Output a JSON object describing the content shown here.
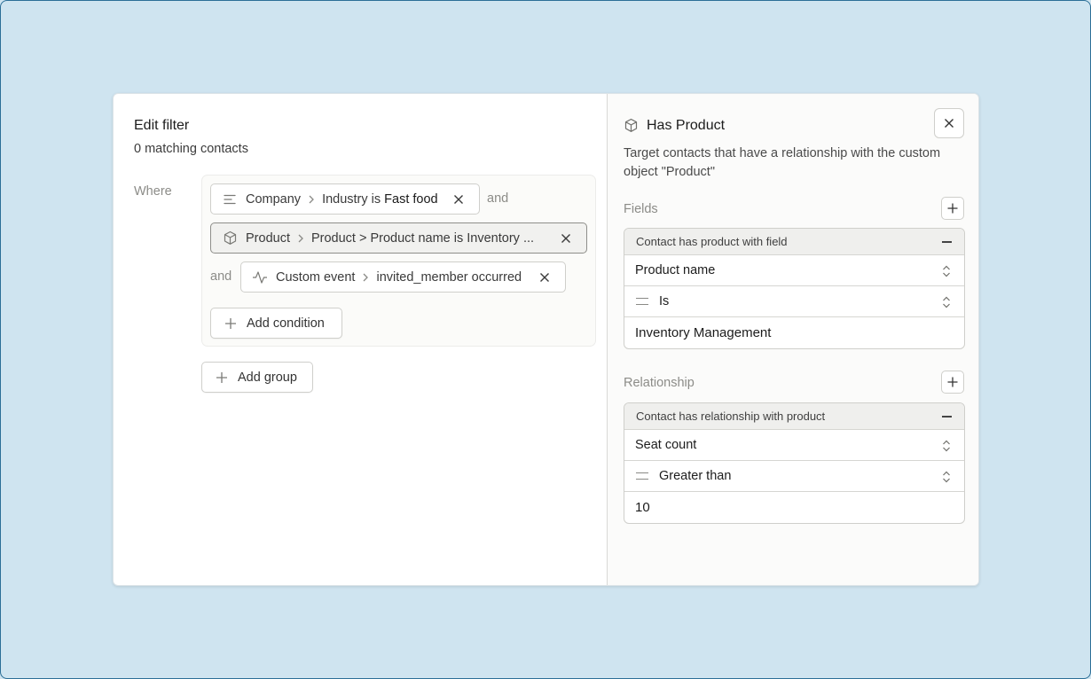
{
  "left": {
    "title": "Edit filter",
    "subtitle": "0 matching contacts",
    "where_label": "Where",
    "conditions": [
      {
        "icon": "text-lines-icon",
        "source": "Company",
        "field_prefix": "Industry is",
        "value": "Fast food",
        "selected": false
      },
      {
        "icon": "cube-icon",
        "source": "Product",
        "text": "Product > Product name is Inventory ...",
        "selected": true
      },
      {
        "icon": "activity-icon",
        "source": "Custom event",
        "text": "invited_member occurred",
        "selected": false
      }
    ],
    "conjunction_1": "and",
    "conjunction_2": "and",
    "add_condition": "Add condition",
    "add_group": "Add group"
  },
  "right": {
    "title": "Has Product",
    "description": "Target contacts that have a relationship with the custom object \"Product\"",
    "fields_label": "Fields",
    "fields_card": {
      "header": "Contact has product with field",
      "field": "Product name",
      "operator": "Is",
      "value": "Inventory Management"
    },
    "relationship_label": "Relationship",
    "relationship_card": {
      "header": "Contact has relationship with product",
      "field": "Seat count",
      "operator": "Greater than",
      "value": "10"
    }
  }
}
